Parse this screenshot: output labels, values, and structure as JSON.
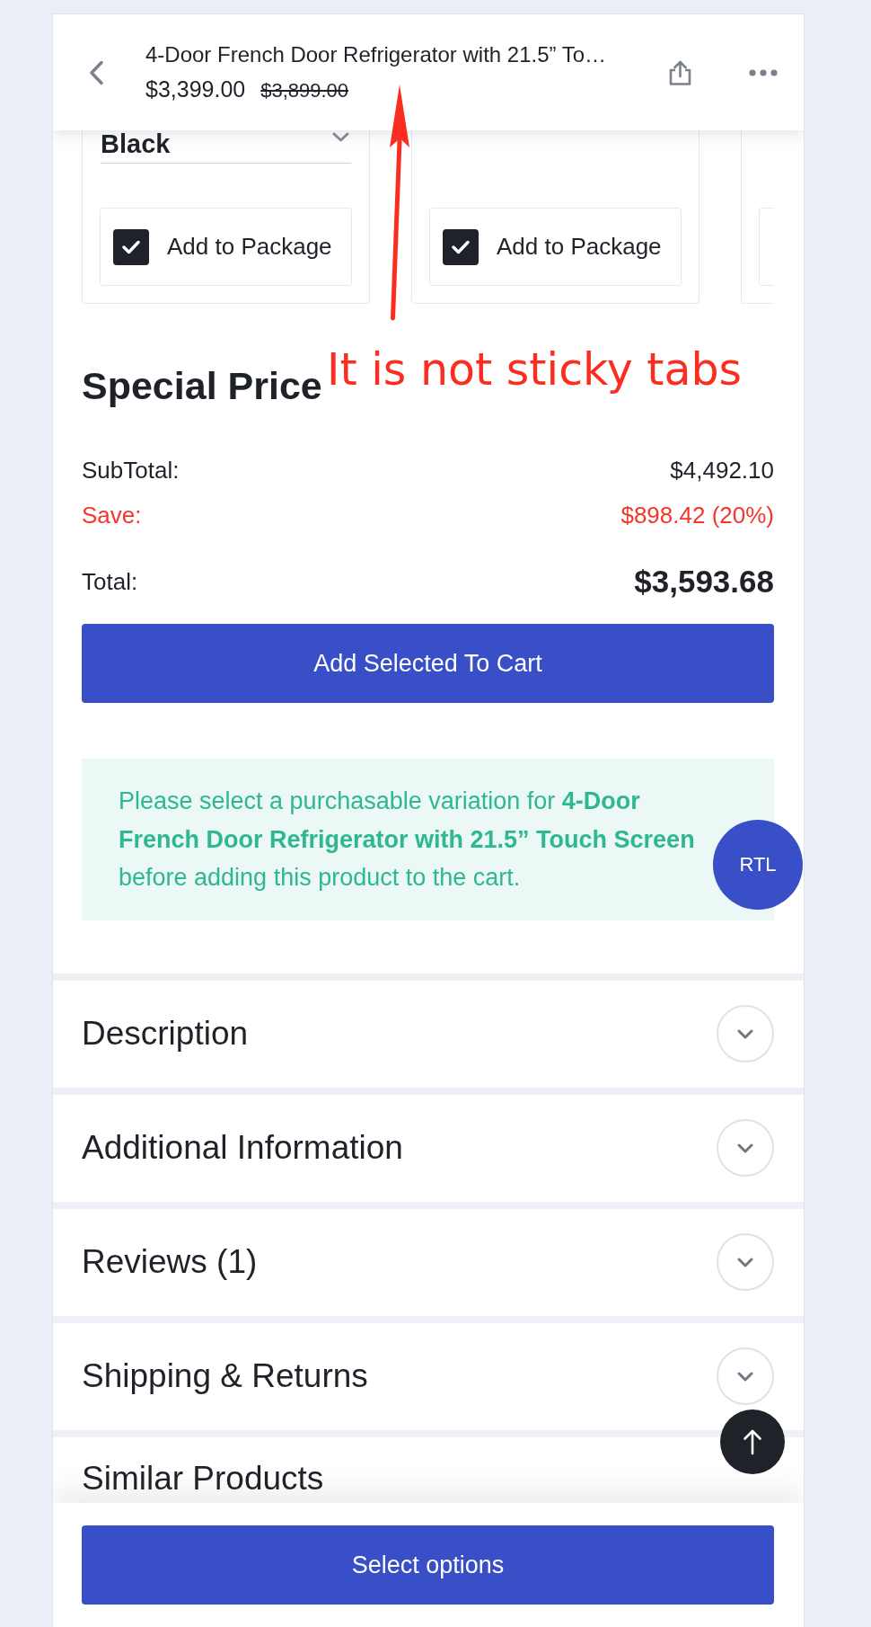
{
  "header": {
    "title": "4-Door French Door Refrigerator with 21.5” To…",
    "price": "$3,399.00",
    "regular_price": "$3,899.00"
  },
  "package_items": [
    {
      "select_value": "Black",
      "option_label": "Add to Package",
      "checked": true
    },
    {
      "option_label": "Add to Package",
      "checked": true
    }
  ],
  "special_price": {
    "title": "Special Price",
    "rows": [
      {
        "kind": "subtotal",
        "label": "SubTotal:",
        "value": "$4,492.10"
      },
      {
        "kind": "save",
        "label": "Save:",
        "value": "$898.42 (20%)"
      },
      {
        "kind": "total",
        "label": "Total:",
        "value": "$3,593.68"
      }
    ],
    "button": "Add Selected To Cart"
  },
  "notice": "Please select a purchasable variation for **4-Door French Door Refrigerator with 21.5” Touch Screen** before adding this product to the cart.",
  "rtl_button": "RTL",
  "accordions": [
    {
      "title": "Description",
      "expanded": false
    },
    {
      "title": "Additional Information",
      "expanded": false
    },
    {
      "title": "Reviews (1)",
      "expanded": false
    },
    {
      "title": "Shipping & Returns",
      "expanded": false
    }
  ],
  "similar_products": {
    "title": "Similar Products"
  },
  "bottom_bar": {
    "button": "Select options"
  },
  "annotation": {
    "text": "It is not sticky tabs"
  }
}
